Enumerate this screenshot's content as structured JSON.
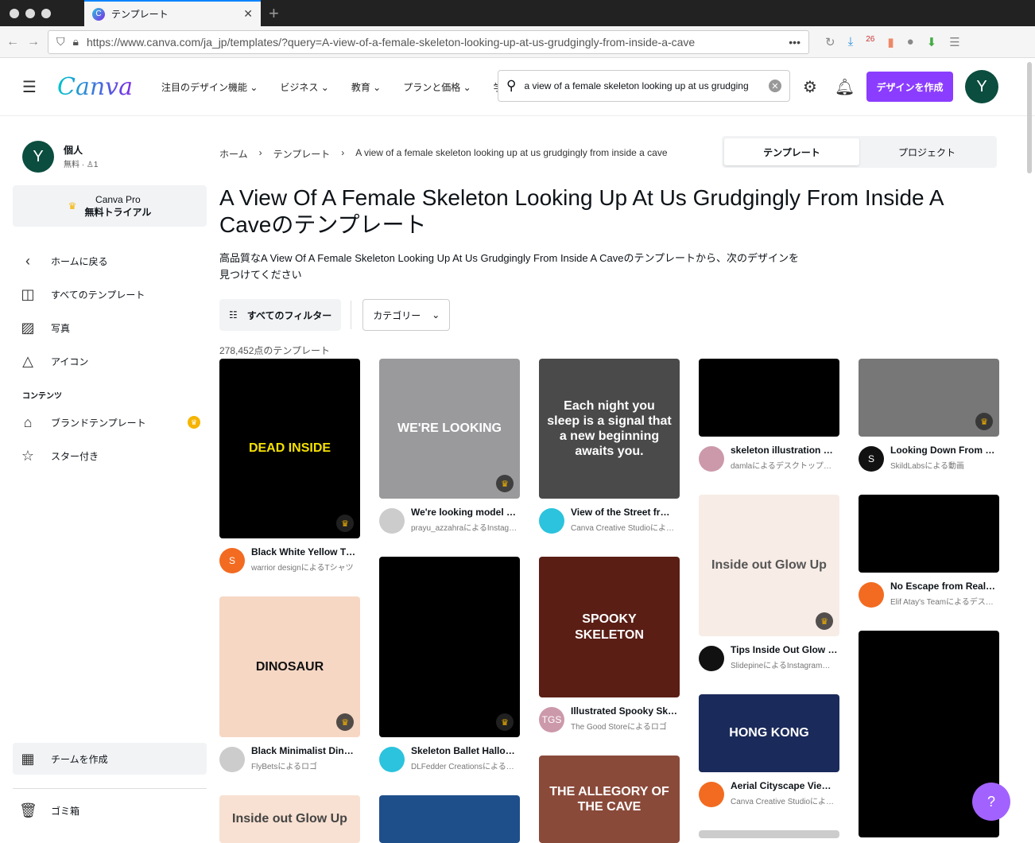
{
  "browser": {
    "tab_title": "テンプレート",
    "url": "https://www.canva.com/ja_jp/templates/?query=A-view-of-a-female-skeleton-looking-up-at-us-grudgingly-from-inside-a-cave",
    "ext_badge": "26"
  },
  "header": {
    "logo": "Canva",
    "menu": [
      "注目のデザイン機能",
      "ビジネス",
      "教育",
      "プランと価格",
      "学ぶ"
    ],
    "search_value": "a view of a female skeleton looking up at us grudging",
    "create_label": "デザインを作成",
    "avatar": "Y"
  },
  "sidebar": {
    "avatar": "Y",
    "name": "個人",
    "plan": "無料",
    "members": "1",
    "pro_line1": "Canva Pro",
    "pro_line2": "無料トライアル",
    "items": [
      "ホームに戻る",
      "すべてのテンプレート",
      "写真",
      "アイコン"
    ],
    "section": "コンテンツ",
    "content_items": [
      "ブランドテンプレート",
      "スター付き"
    ],
    "team": "チームを作成",
    "trash": "ゴミ箱"
  },
  "main": {
    "breadcrumb": [
      "ホーム",
      "テンプレート",
      "A view of a female skeleton looking up at us grudgingly from inside a cave"
    ],
    "tabs": [
      "テンプレート",
      "プロジェクト"
    ],
    "title": "A View Of A Female Skeleton Looking Up At Us Grudgingly From Inside A Caveのテンプレート",
    "description": "高品質なA View Of A Female Skeleton Looking Up At Us Grudgingly From Inside A Caveのテンプレートから、次のデザインを見つけてください",
    "filters_label": "すべてのフィルター",
    "category_label": "カテゴリー",
    "count": "278,452点のテンプレート"
  },
  "columns": [
    [
      {
        "title": "Black White Yellow T…",
        "by": "warrior designによるTシャツ",
        "img_text": "DEAD INSIDE",
        "avatar": "S"
      },
      {
        "title": "Black Minimalist Dino…",
        "by": "FlyBetsによるロゴ",
        "img_text": "DINOSAUR"
      },
      {
        "title": "",
        "by": "",
        "img_text": "Inside out Glow Up"
      }
    ],
    [
      {
        "title": "We're looking model i…",
        "by": "prayu_azzahraによるInstag…",
        "img_text": "WE'RE LOOKING"
      },
      {
        "title": "Skeleton Ballet Hallo…",
        "by": "DLFedder CreationsによるT…",
        "img_text": ""
      },
      {
        "title": "",
        "by": "",
        "img_text": ""
      }
    ],
    [
      {
        "title": "View of the Street fr…",
        "by": "Canva Creative Studioによ…",
        "img_text": "Each night you sleep is a signal that a new beginning awaits you."
      },
      {
        "title": "Illustrated Spooky Sk…",
        "by": "The Good Storeによるロゴ",
        "img_text": "SPOOKY SKELETON",
        "avatar": "TGS"
      },
      {
        "title": "",
        "by": "",
        "img_text": "THE ALLEGORY OF THE CAVE"
      }
    ],
    [
      {
        "title": "skeleton illustration …",
        "by": "damlaによるデスクトップ壁紙",
        "img_text": ""
      },
      {
        "title": "Tips Inside Out Glow …",
        "by": "SlidepineによるInstagramの…",
        "img_text": "Inside out Glow Up"
      },
      {
        "title": "Aerial Cityscape View…",
        "by": "Canva Creative Studioによ…",
        "img_text": "HONG KONG"
      },
      {
        "title": "",
        "by": "",
        "img_text": ""
      }
    ],
    [
      {
        "title": "Looking Down From …",
        "by": "SkildLabsによる動画",
        "img_text": "",
        "avatar": "S"
      },
      {
        "title": "No Escape from Reali…",
        "by": "Elif Atay's Teamによるデス…",
        "img_text": ""
      },
      {
        "title": "",
        "by": "",
        "img_text": ""
      }
    ]
  ],
  "help": "?"
}
